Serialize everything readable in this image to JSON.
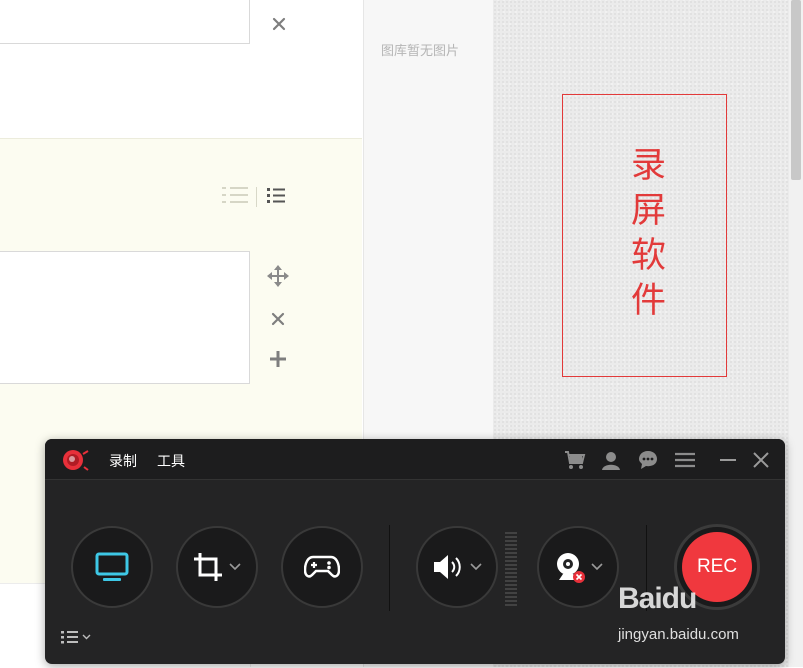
{
  "editor": {
    "title_value": "",
    "step_value": ""
  },
  "gallery": {
    "empty_text": "图库暂无图片"
  },
  "preview": {
    "stamp_text": "录屏软件"
  },
  "recorder": {
    "menu": [
      "录制",
      "工具"
    ],
    "rec_label": "REC",
    "colors": {
      "accent": "#f0383e",
      "screen_icon": "#3ec8e6",
      "background": "#242425"
    }
  },
  "watermark": {
    "brand": "Baidu",
    "url": "jingyan.baidu.com"
  },
  "icons": [
    "close-icon",
    "numbered-list-icon",
    "bullet-list-icon",
    "move-icon",
    "plus-icon",
    "app-logo",
    "cart-icon",
    "user-icon",
    "chat-icon",
    "menu-icon",
    "minimize-icon",
    "close-icon",
    "monitor-icon",
    "crop-icon",
    "gamepad-icon",
    "speaker-icon",
    "webcam-icon",
    "chevron-down-icon",
    "list-icon"
  ]
}
